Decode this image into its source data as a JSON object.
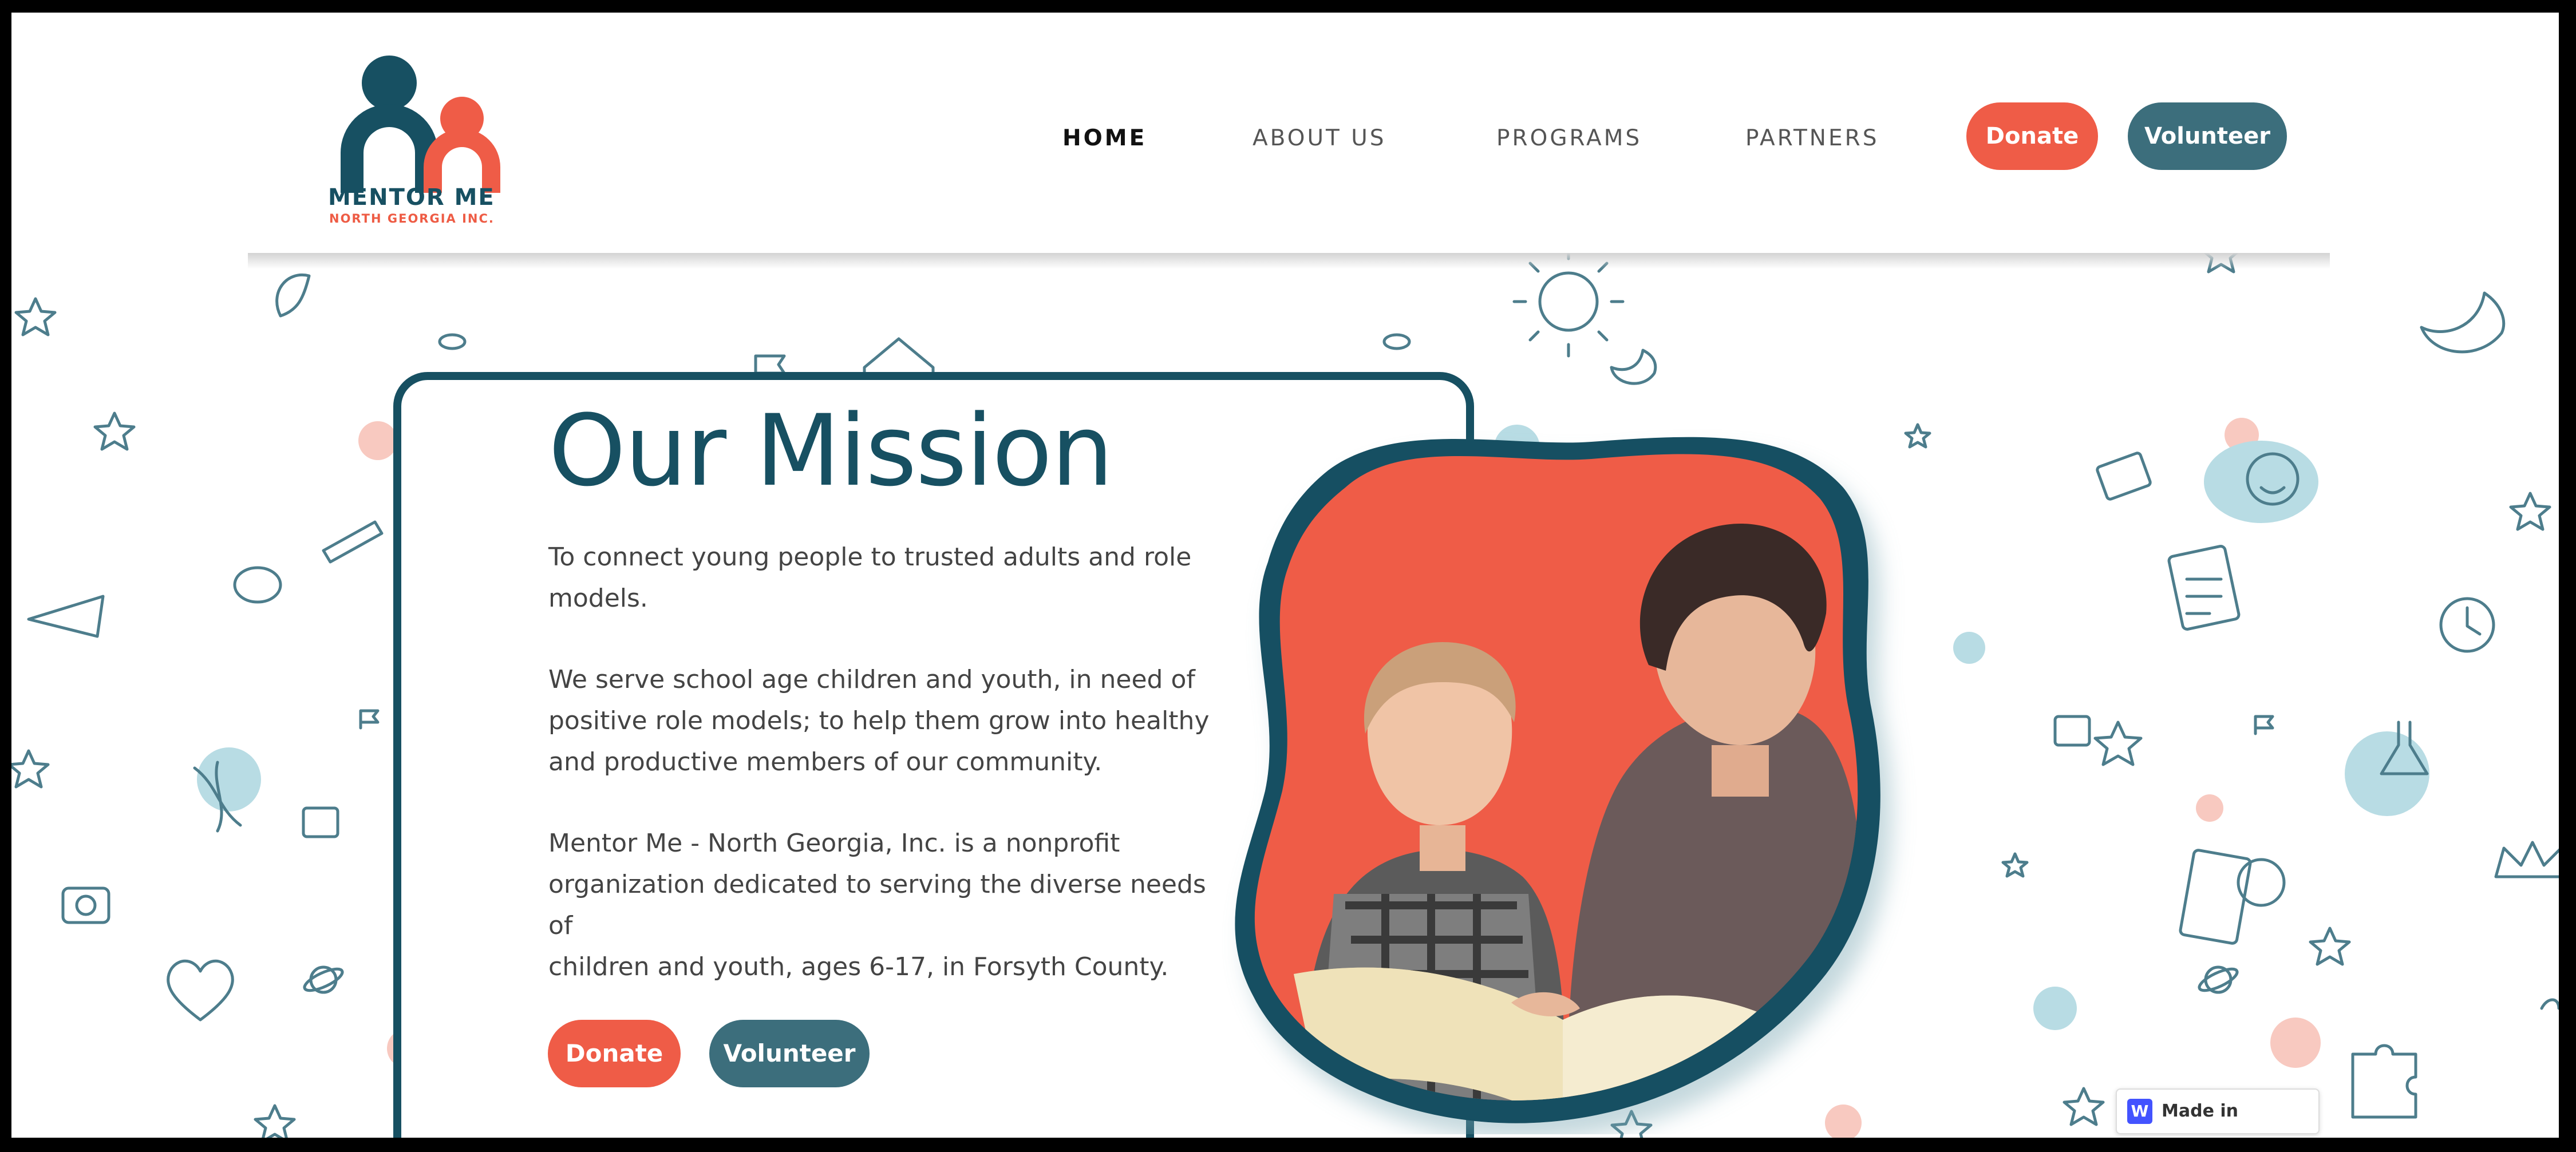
{
  "brand": {
    "name": "MENTOR ME",
    "subtitle": "NORTH GEORGIA INC.",
    "colors": {
      "teal": "#175062",
      "coral": "#ef5c47",
      "button_teal": "#3c6e7c"
    }
  },
  "nav": {
    "items": [
      {
        "label": "HOME",
        "active": true
      },
      {
        "label": "ABOUT US",
        "active": false
      },
      {
        "label": "PROGRAMS",
        "active": false
      },
      {
        "label": "PARTNERS",
        "active": false
      }
    ],
    "donate_label": "Donate",
    "volunteer_label": "Volunteer"
  },
  "mission": {
    "title": "Our Mission",
    "paragraphs": [
      [
        "To connect young people to trusted adults and role",
        "models."
      ],
      [
        "We serve school age children and youth, in need of",
        "positive role models; to help them grow into healthy",
        "and productive members of our community."
      ],
      [
        "Mentor Me - North Georgia, Inc. is a nonprofit",
        "organization dedicated to serving the diverse needs of",
        "children and youth, ages 6-17, in Forsyth County."
      ]
    ],
    "donate_label": "Donate",
    "volunteer_label": "Volunteer"
  },
  "hero_image": {
    "icon": "mentor-reading-with-child-photo"
  },
  "badge": {
    "icon": "webflow-icon",
    "icon_letter": "W",
    "label": "Made in Webflow"
  }
}
